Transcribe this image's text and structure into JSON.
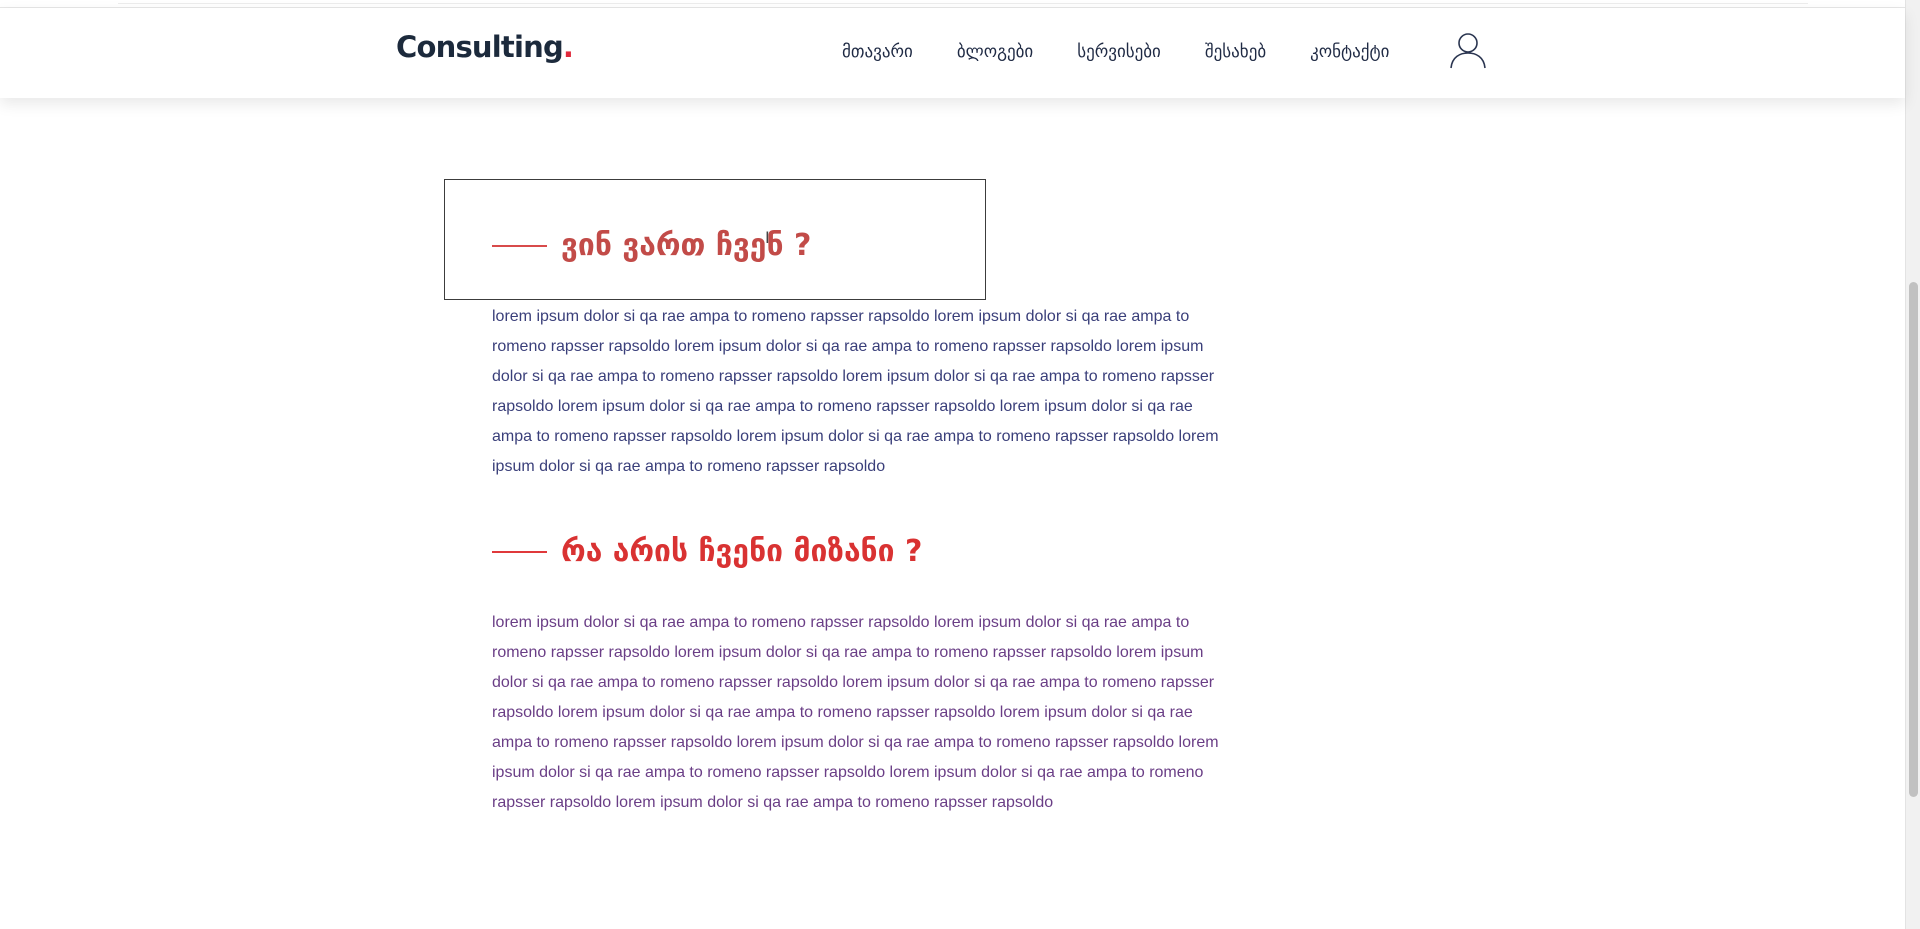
{
  "header": {
    "logo_text": "Consulting",
    "logo_dot": ".",
    "nav_items": [
      {
        "label": "მთავარი"
      },
      {
        "label": "ბლოგები"
      },
      {
        "label": "სერვისები"
      },
      {
        "label": "შესახებ"
      },
      {
        "label": "კონტაქტი"
      }
    ],
    "user_icon": "user-icon"
  },
  "sections": [
    {
      "title": "ვინ ვართ ჩვენ ?",
      "body": "lorem ipsum dolor si qa rae ampa to romeno rapsser rapsoldo lorem ipsum dolor si qa rae ampa to romeno rapsser rapsoldo lorem ipsum dolor si qa rae ampa to romeno rapsser rapsoldo lorem ipsum dolor si qa rae ampa to romeno rapsser rapsoldo lorem ipsum dolor si qa rae ampa to romeno rapsser rapsoldo lorem ipsum dolor si qa rae ampa to romeno rapsser rapsoldo lorem ipsum dolor si qa rae ampa to romeno rapsser rapsoldo lorem ipsum dolor si qa rae ampa to romeno rapsser rapsoldo lorem ipsum dolor si qa rae ampa to romeno rapsser rapsoldo"
    },
    {
      "title": "რა არის ჩვენი მიზანი ?",
      "body": "lorem ipsum dolor si qa rae ampa to romeno rapsser rapsoldo lorem ipsum dolor si qa rae ampa to romeno rapsser rapsoldo lorem ipsum dolor si qa rae ampa to romeno rapsser rapsoldo lorem ipsum dolor si qa rae ampa to romeno rapsser rapsoldo lorem ipsum dolor si qa rae ampa to romeno rapsser rapsoldo lorem ipsum dolor si qa rae ampa to romeno rapsser rapsoldo lorem ipsum dolor si qa rae ampa to romeno rapsser rapsoldo lorem ipsum dolor si qa rae ampa to romeno rapsser rapsoldo lorem ipsum dolor si qa rae ampa to romeno rapsser rapsoldo lorem ipsum dolor si qa rae ampa to romeno rapsser rapsoldo lorem ipsum dolor si qa rae ampa to romeno rapsser rapsoldo"
    }
  ],
  "colors": {
    "accent": "#e0293b",
    "heading_1": "#c24b48",
    "heading_2": "#d93232",
    "body_1": "#3a3f7a",
    "body_2": "#6a3e86",
    "logo": "#1c2a3c"
  }
}
